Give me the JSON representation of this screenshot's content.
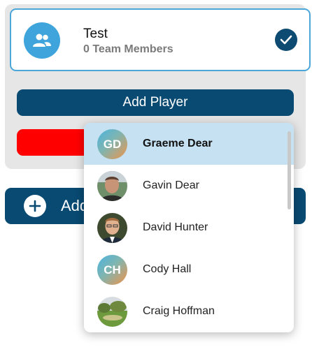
{
  "team": {
    "name": "Test",
    "members": "0 Team Members",
    "avatar_icon": "team-users-icon",
    "selected_icon": "check-icon"
  },
  "buttons": {
    "add_player": "Add Player",
    "add_team": "Add"
  },
  "colors": {
    "accent_blue": "#3fa3dc",
    "primary_dark": "#094a72",
    "danger_red": "#ff0000",
    "selected_row": "#c6e1f2"
  },
  "player_dropdown": {
    "items": [
      {
        "name": "Graeme Dear",
        "initials": "GD",
        "selected": true
      },
      {
        "name": "Gavin Dear",
        "avatar": "photo"
      },
      {
        "name": "David Hunter",
        "avatar": "photo"
      },
      {
        "name": "Cody Hall",
        "initials": "CH"
      },
      {
        "name": "Craig Hoffman",
        "avatar": "photo"
      }
    ]
  }
}
